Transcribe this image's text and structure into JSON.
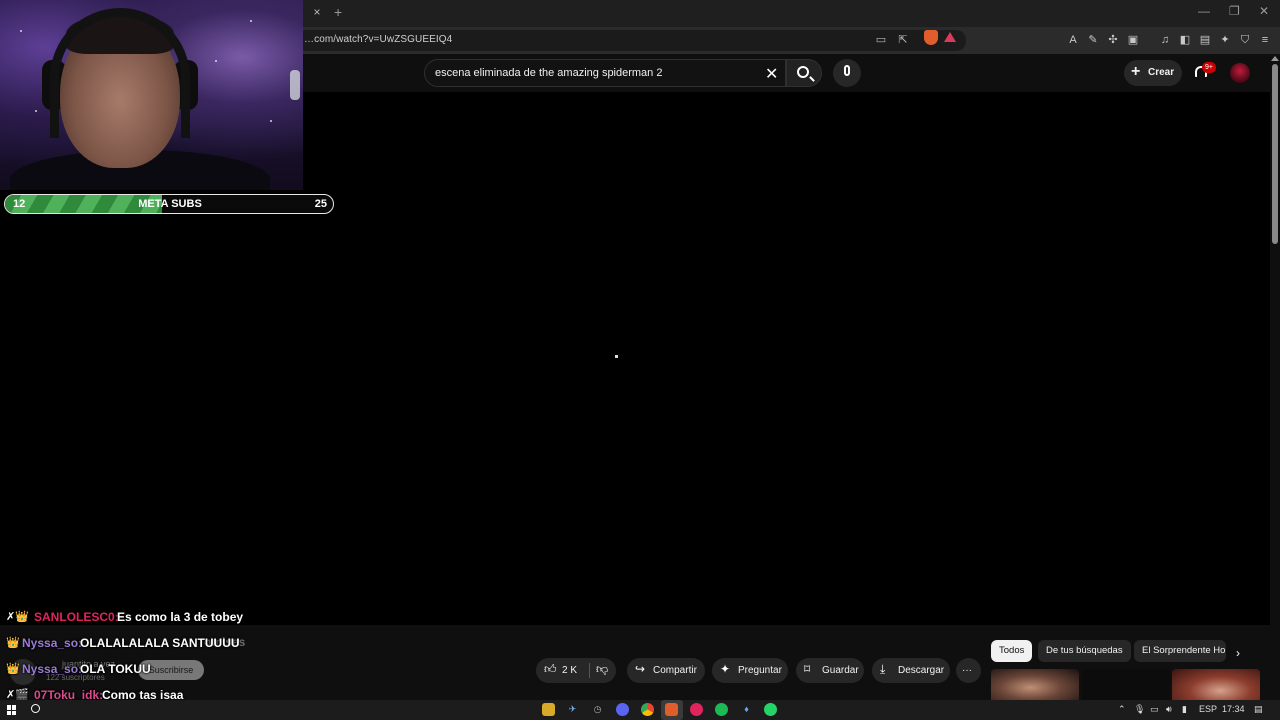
{
  "browser": {
    "tab_close": "×",
    "tab_new": "+",
    "window_controls": {
      "minimize": "—",
      "maximize": "❐",
      "close": "✕"
    },
    "url": "…com/watch?v=UwZSGUEEIQ4"
  },
  "youtube": {
    "search": {
      "value": "escena eliminada de the amazing spiderman 2",
      "clear": "✕"
    },
    "create_label": "Crear",
    "create_plus": "+",
    "notifications_badge": "9+",
    "actions": {
      "likes": "2 K",
      "share": "Compartir",
      "ask": "Preguntar",
      "save": "Guardar",
      "download": "Descargar",
      "more": "···"
    },
    "chips": [
      "Todos",
      "De tus búsquedas",
      "El Sorprendente Ho"
    ],
    "chip_next": "›",
    "faded": {
      "channel_name": "juantito a vez",
      "subscribers": "122 suscriptores",
      "subscribe_label": "Suscribirse",
      "title_fragment": "omises"
    }
  },
  "stream_overlay": {
    "sub_goal": {
      "current": "12",
      "title": "META SUBS",
      "target": "25",
      "progress": 0.48
    },
    "chat": [
      {
        "badges": "✗👑",
        "user": "SANLOLESC0:",
        "user_color": "#e0245e",
        "message": "Es como la 3 de tobey"
      },
      {
        "badges": "👑",
        "user": "Nyssa_so:",
        "user_color": "#9b7bd8",
        "message": "OLALALALALA SANTUUUU"
      },
      {
        "badges": "👑",
        "user": "Nyssa_so:",
        "user_color": "#9b7bd8",
        "message": "OLA TOKUU"
      },
      {
        "badges": "✗🎬",
        "user": "07Toku_idk:",
        "user_color": "#d84b8c",
        "message": "Como tas isaa"
      }
    ]
  },
  "taskbar": {
    "tray": {
      "language": "ESP",
      "time": "17:34"
    }
  }
}
